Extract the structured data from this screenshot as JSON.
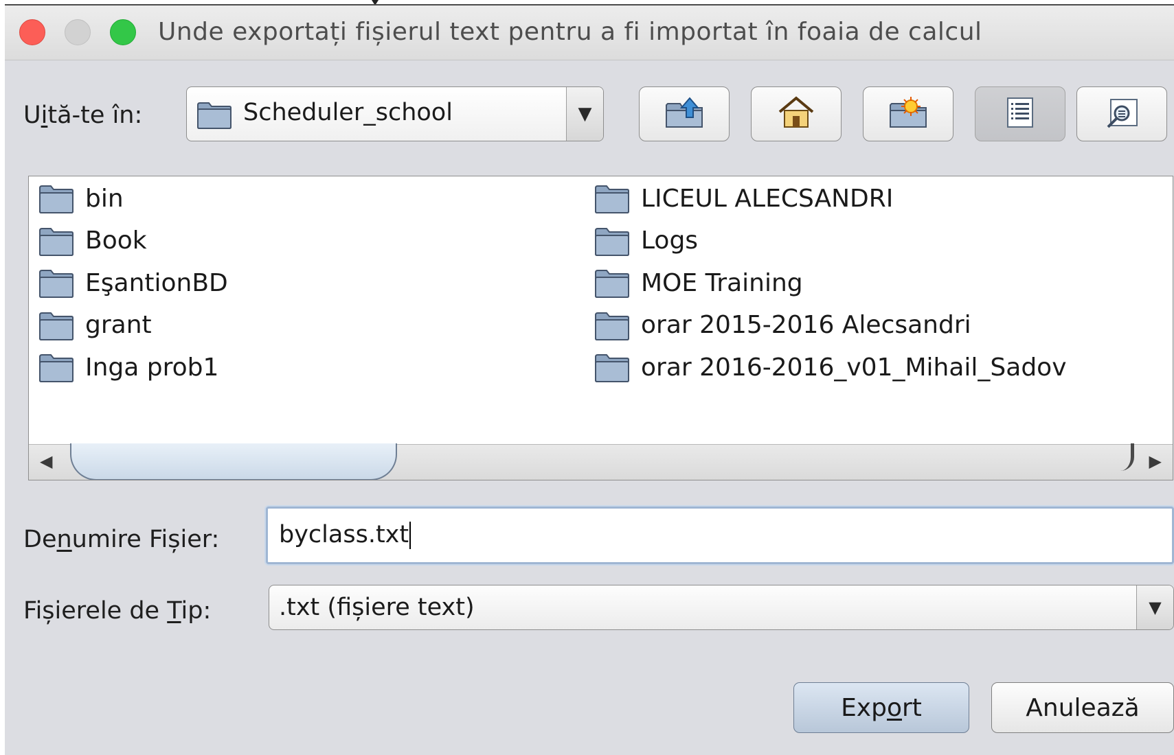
{
  "window": {
    "title": "Unde exportați fișierul text pentru a fi importat în foaia de calcul"
  },
  "look_in": {
    "label_pre": "U",
    "label_mnemonic": "i",
    "label_post": "tă-te în:",
    "current_folder": "Scheduler_school"
  },
  "toolbar": {
    "buttons": [
      {
        "icon": "up-folder-icon"
      },
      {
        "icon": "home-icon"
      },
      {
        "icon": "new-folder-icon"
      },
      {
        "icon": "list-view-icon",
        "pressed": true
      },
      {
        "icon": "details-view-icon"
      }
    ]
  },
  "files": {
    "left_column": [
      "bin",
      "Book",
      "EşantionBD",
      "grant",
      "Inga prob1"
    ],
    "right_column": [
      "LICEUL ALECSANDRI",
      "Logs",
      "MOE Training",
      "orar 2015-2016 Alecsandri",
      "orar 2016-2016_v01_Mihail_Sadov"
    ]
  },
  "filename": {
    "label_pre": "De",
    "label_mnemonic": "n",
    "label_post": "umire Fișier:",
    "value": "byclass.txt"
  },
  "filetype": {
    "label_pre": "Fișierele de ",
    "label_mnemonic": "T",
    "label_post": "ip:",
    "selected": ".txt (fișiere text)"
  },
  "actions": {
    "export_pre": "Exp",
    "export_mnemonic": "o",
    "export_post": "rt",
    "cancel_label": "Anulează"
  }
}
